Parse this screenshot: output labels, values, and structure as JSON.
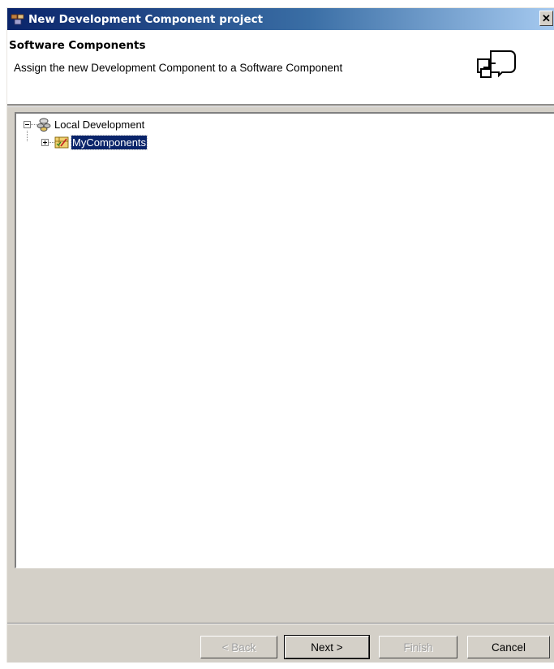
{
  "window": {
    "title": "New Development Component project",
    "close_label": "✕"
  },
  "header": {
    "title": "Software Components",
    "description": "Assign the new Development Component to a Software Component"
  },
  "tree": {
    "root": {
      "label": "Local Development",
      "expanded": true,
      "icon": "network-icon"
    },
    "child": {
      "label": "MyComponents",
      "expanded": false,
      "selected": true,
      "icon": "software-component-icon"
    }
  },
  "buttons": {
    "back": {
      "label": "< Back",
      "enabled": false
    },
    "next": {
      "label": "Next >",
      "enabled": true
    },
    "finish": {
      "label": "Finish",
      "enabled": false
    },
    "cancel": {
      "label": "Cancel",
      "enabled": true
    }
  },
  "colors": {
    "title_bar_start": "#0a246a",
    "title_bar_end": "#a6caf0",
    "selection": "#0a246a",
    "dialog_face": "#d4d0c8"
  }
}
